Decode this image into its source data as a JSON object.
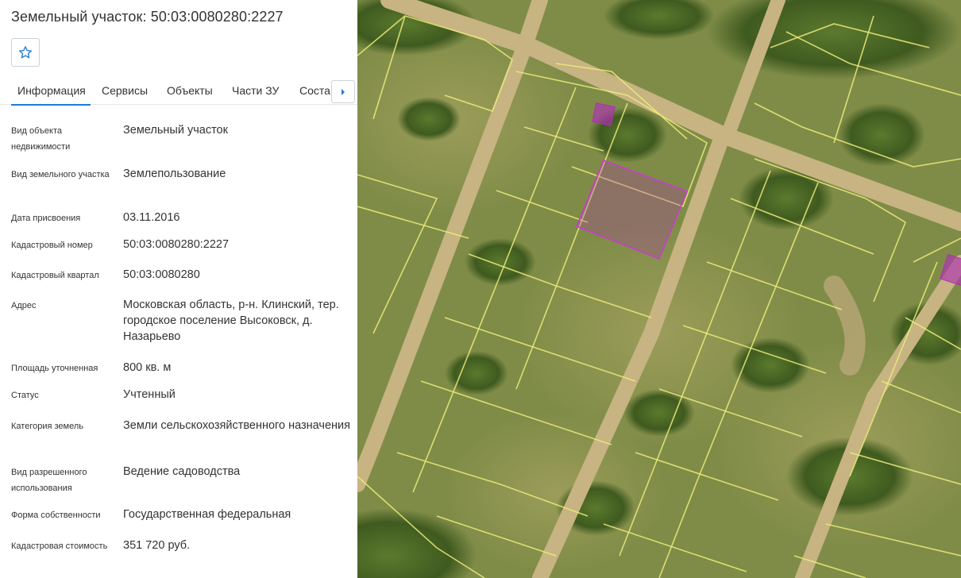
{
  "header": {
    "title": "Земельный участок: 50:03:0080280:2227"
  },
  "tabs": [
    {
      "label": "Информация"
    },
    {
      "label": "Сервисы"
    },
    {
      "label": "Объекты"
    },
    {
      "label": "Части ЗУ"
    },
    {
      "label": "Состав"
    }
  ],
  "icons": {
    "favorite": "star-icon",
    "tabs_next": "chevron-right-icon"
  },
  "colors": {
    "accent": "#1e7bd8",
    "parcel_border": "#ecec7a",
    "selected_parcel": "#b02fb5"
  },
  "info": [
    {
      "label": "Вид объекта недвижимости",
      "value": "Земельный участок"
    },
    {
      "label": "Вид земельного участка",
      "value": "Землепользование"
    },
    {
      "label": "Дата присвоения",
      "value": "03.11.2016"
    },
    {
      "label": "Кадастровый номер",
      "value": "50:03:0080280:2227"
    },
    {
      "label": "Кадастровый квартал",
      "value": "50:03:0080280"
    },
    {
      "label": "Адрес",
      "value": "Московская область, р-н. Клинский, тер. городское поселение Высоковск, д. Назарьево"
    },
    {
      "label": "Площадь уточненная",
      "value": "800 кв. м"
    },
    {
      "label": "Статус",
      "value": "Учтенный"
    },
    {
      "label": "Категория земель",
      "value": "Земли сельскохозяйственного назначения"
    },
    {
      "label": "Вид разрешенного использования",
      "value": "Ведение садоводства"
    },
    {
      "label": "Форма собственности",
      "value": "Государственная федеральная"
    },
    {
      "label": "Кадастровая стоимость",
      "value": "351 720 руб."
    }
  ]
}
